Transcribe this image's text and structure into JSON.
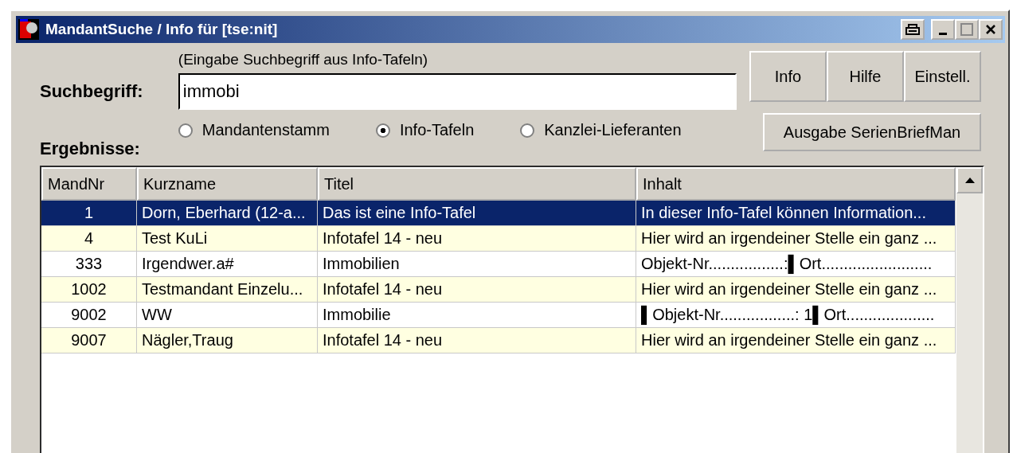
{
  "window": {
    "title": "MandantSuche / Info für [tse:nit]"
  },
  "search": {
    "label": "Suchbegriff:",
    "hint": "(Eingabe Suchbegriff aus Info-Tafeln)",
    "value": "immobi"
  },
  "buttons": [
    {
      "label": "Info"
    },
    {
      "label": "Hilfe"
    },
    {
      "label": "Einstell."
    }
  ],
  "scope": [
    {
      "label": "Mandantenstamm",
      "selected": false
    },
    {
      "label": "Info-Tafeln",
      "selected": true
    },
    {
      "label": "Kanzlei-Lieferanten",
      "selected": false
    }
  ],
  "export_button": "Ausgabe SerienBriefMan",
  "results_label": "Ergebnisse:",
  "table": {
    "columns": [
      "MandNr",
      "Kurzname",
      "Titel",
      "Inhalt"
    ],
    "rows": [
      {
        "cells": [
          "1",
          "Dorn, Eberhard (12-a...",
          "Das ist eine Info-Tafel",
          "In dieser Info-Tafel können Information..."
        ],
        "selected": true
      },
      {
        "cells": [
          "4",
          "Test KuLi",
          "Infotafel 14 - neu",
          "Hier wird an irgendeiner Stelle ein ganz ..."
        ],
        "selected": false
      },
      {
        "cells": [
          "333",
          "Irgendwer.a#",
          "Immobilien",
          "Objekt-Nr.................:▌Ort........................."
        ],
        "selected": false
      },
      {
        "cells": [
          "1002",
          "Testmandant Einzelu...",
          "Infotafel 14 - neu",
          "Hier wird an irgendeiner Stelle ein ganz ..."
        ],
        "selected": false
      },
      {
        "cells": [
          "9002",
          "WW",
          "Immobilie",
          "▌Objekt-Nr.................: 1▌Ort...................."
        ],
        "selected": false
      },
      {
        "cells": [
          "9007",
          "Nägler,Traug",
          "Infotafel 14 - neu",
          "Hier wird an irgendeiner Stelle ein ganz ..."
        ],
        "selected": false
      }
    ]
  }
}
